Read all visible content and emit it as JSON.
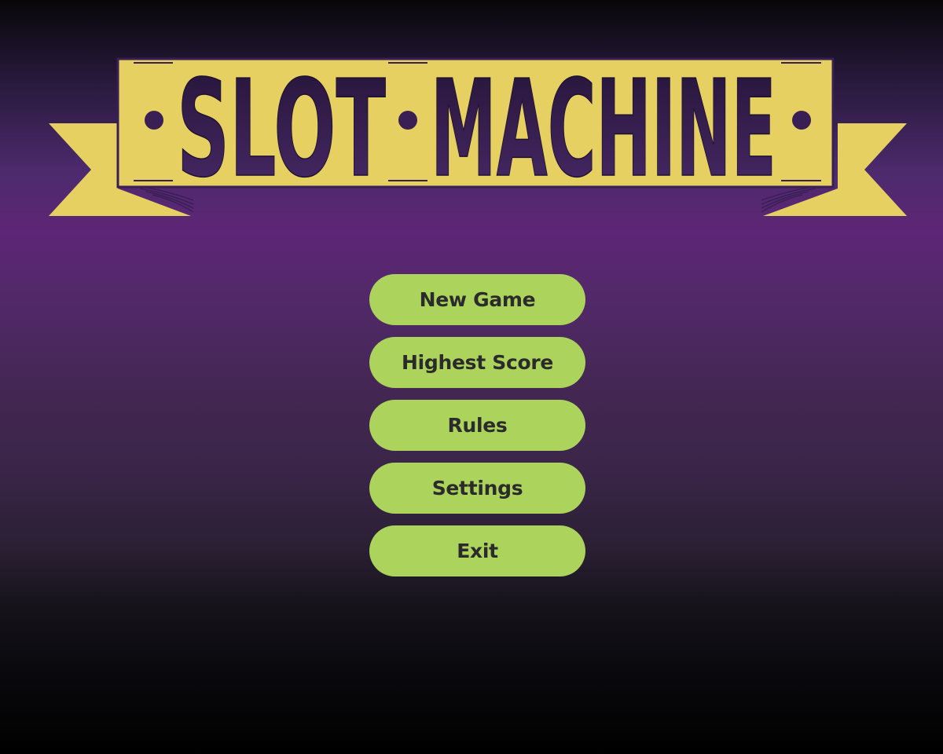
{
  "game": {
    "title": "SLOT MACHINE",
    "title_word_1": "SLOT",
    "title_word_2": "MACHINE"
  },
  "menu": {
    "items": [
      {
        "label": "New Game"
      },
      {
        "label": "Highest Score"
      },
      {
        "label": "Rules"
      },
      {
        "label": "Settings"
      },
      {
        "label": "Exit"
      }
    ]
  },
  "colors": {
    "banner_yellow": "#e6d062",
    "title_purple": "#3a1f55",
    "button_green": "#acd45c",
    "button_text": "#2b2b2b",
    "background_purple": "#5e2676",
    "background_dark": "#000000"
  }
}
